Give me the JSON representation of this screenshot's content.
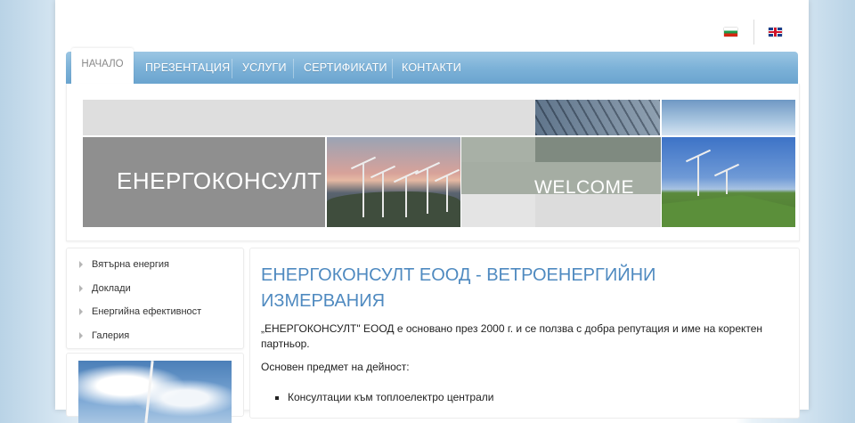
{
  "languages": [
    {
      "code": "bg",
      "icon": "bulgarian-flag-icon"
    },
    {
      "code": "en",
      "icon": "uk-flag-icon"
    }
  ],
  "nav": {
    "active": "НАЧАЛО",
    "items": [
      "ПРЕЗЕНТАЦИЯ",
      "УСЛУГИ",
      "СЕРТИФИКАТИ",
      "КОНТАКТИ"
    ]
  },
  "banner": {
    "title": "ЕНЕРГОКОНСУЛТ",
    "welcome": "WELCOME"
  },
  "sidebar": {
    "items": [
      "Вятърна енергия",
      "Доклади",
      "Енергийна ефективност",
      "Галерия"
    ]
  },
  "content": {
    "heading": "ЕНЕРГОКОНСУЛТ ЕООД - ВЕТРОЕНЕРГИЙНИ ИЗМЕРВАНИЯ",
    "intro": "„ЕНЕРГОКОНСУЛТ\" ЕООД е основано през 2000 г. и се ползва с  добра репутация и име на коректен партньор.",
    "subject": "Основен предмет на дейност:",
    "list": [
      "Консултации към топлоелектро централи"
    ]
  },
  "colors": {
    "accent": "#4f8ac0",
    "nav": "#7db2d8"
  }
}
